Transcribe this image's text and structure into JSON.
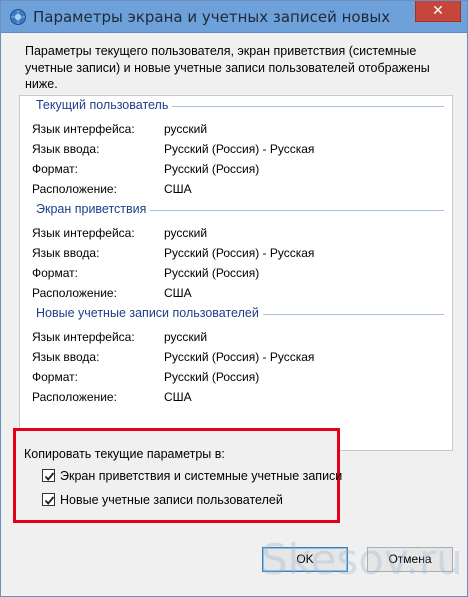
{
  "window": {
    "title": "Параметры экрана и учетных записей новых пользоват..."
  },
  "intro_text": "Параметры текущего пользователя, экран приветствия (системные учетные записи) и новые учетные записи пользователей отображены ниже.",
  "sections": [
    {
      "title": "Текущий пользователь",
      "rows": [
        {
          "label": "Язык интерфейса:",
          "value": "русский"
        },
        {
          "label": "Язык ввода:",
          "value": "Русский (Россия) - Русская"
        },
        {
          "label": "Формат:",
          "value": "Русский (Россия)"
        },
        {
          "label": "Расположение:",
          "value": "США"
        }
      ]
    },
    {
      "title": "Экран приветствия",
      "rows": [
        {
          "label": "Язык интерфейса:",
          "value": "русский"
        },
        {
          "label": "Язык ввода:",
          "value": "Русский (Россия) - Русская"
        },
        {
          "label": "Формат:",
          "value": "Русский (Россия)"
        },
        {
          "label": "Расположение:",
          "value": "США"
        }
      ]
    },
    {
      "title": "Новые учетные записи пользователей",
      "rows": [
        {
          "label": "Язык интерфейса:",
          "value": "русский"
        },
        {
          "label": "Язык ввода:",
          "value": "Русский (Россия) - Русская"
        },
        {
          "label": "Формат:",
          "value": "Русский (Россия)"
        },
        {
          "label": "Расположение:",
          "value": "США"
        }
      ]
    }
  ],
  "copy": {
    "title": "Копировать текущие параметры в:",
    "options": [
      {
        "label": "Экран приветствия и системные учетные записи",
        "checked": true
      },
      {
        "label": "Новые учетные записи пользователей",
        "checked": true
      }
    ]
  },
  "buttons": {
    "ok": "OK",
    "cancel": "Отмена"
  },
  "watermark": "Skesov.ru",
  "colors": {
    "titlebar": "#6ea1d9",
    "section_title": "#1e3e8c",
    "highlight_border": "#e2001a"
  }
}
